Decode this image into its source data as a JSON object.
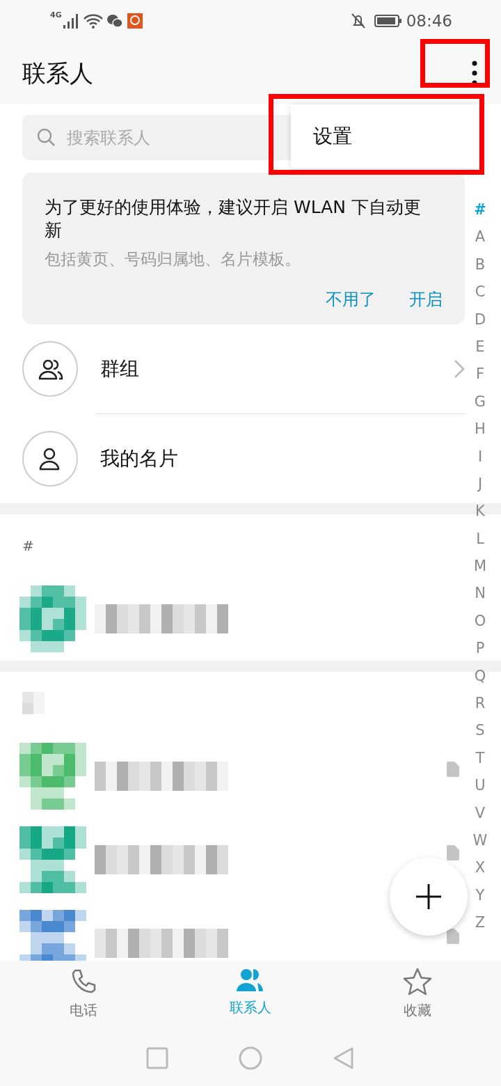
{
  "status_bar": {
    "network": "4G",
    "time": "08:46"
  },
  "header": {
    "title": "联系人"
  },
  "menu": {
    "items": [
      {
        "label": "设置"
      }
    ]
  },
  "annotations": [
    {
      "kind": "highlight"
    },
    {
      "kind": "highlight"
    }
  ],
  "search": {
    "placeholder": "搜索联系人"
  },
  "banner": {
    "title": "为了更好的使用体验，建议开启 WLAN 下自动更新",
    "subtitle": "包括黄页、号码归属地、名片模板。",
    "actions": [
      {
        "label": "不用了"
      },
      {
        "label": "开启"
      }
    ]
  },
  "entries": [
    {
      "label": "群组",
      "kind": "group",
      "chevron": true
    },
    {
      "label": "我的名片",
      "kind": "card",
      "chevron": false
    }
  ],
  "sections": [
    {
      "kind": "letter",
      "header": "#",
      "contacts": [
        {
          "color": "#1aaa8a",
          "card_icon": false
        }
      ]
    },
    {
      "kind": "blurred",
      "contacts": [
        {
          "color": "#4cbb6c",
          "card_icon": true
        },
        {
          "color": "#14a887",
          "card_icon": true
        },
        {
          "color": "#4a88d0",
          "card_icon": true
        }
      ]
    }
  ],
  "index": [
    {
      "label": "#",
      "selected": true
    },
    {
      "label": "A",
      "selected": false
    },
    {
      "label": "B",
      "selected": false
    },
    {
      "label": "C",
      "selected": false
    },
    {
      "label": "D",
      "selected": false
    },
    {
      "label": "E",
      "selected": false
    },
    {
      "label": "F",
      "selected": false
    },
    {
      "label": "G",
      "selected": false
    },
    {
      "label": "H",
      "selected": false
    },
    {
      "label": "I",
      "selected": false
    },
    {
      "label": "J",
      "selected": false
    },
    {
      "label": "K",
      "selected": false
    },
    {
      "label": "L",
      "selected": false
    },
    {
      "label": "M",
      "selected": false
    },
    {
      "label": "N",
      "selected": false
    },
    {
      "label": "O",
      "selected": false
    },
    {
      "label": "P",
      "selected": false
    },
    {
      "label": "Q",
      "selected": false
    },
    {
      "label": "R",
      "selected": false
    },
    {
      "label": "S",
      "selected": false
    },
    {
      "label": "T",
      "selected": false
    },
    {
      "label": "U",
      "selected": false
    },
    {
      "label": "V",
      "selected": false
    },
    {
      "label": "W",
      "selected": false
    },
    {
      "label": "X",
      "selected": false
    },
    {
      "label": "Y",
      "selected": false
    },
    {
      "label": "Z",
      "selected": false
    }
  ],
  "tabs": [
    {
      "label": "电话",
      "kind": "phone",
      "selected": false
    },
    {
      "label": "联系人",
      "kind": "contacts",
      "selected": true
    },
    {
      "label": "收藏",
      "kind": "favorites",
      "selected": false
    }
  ]
}
